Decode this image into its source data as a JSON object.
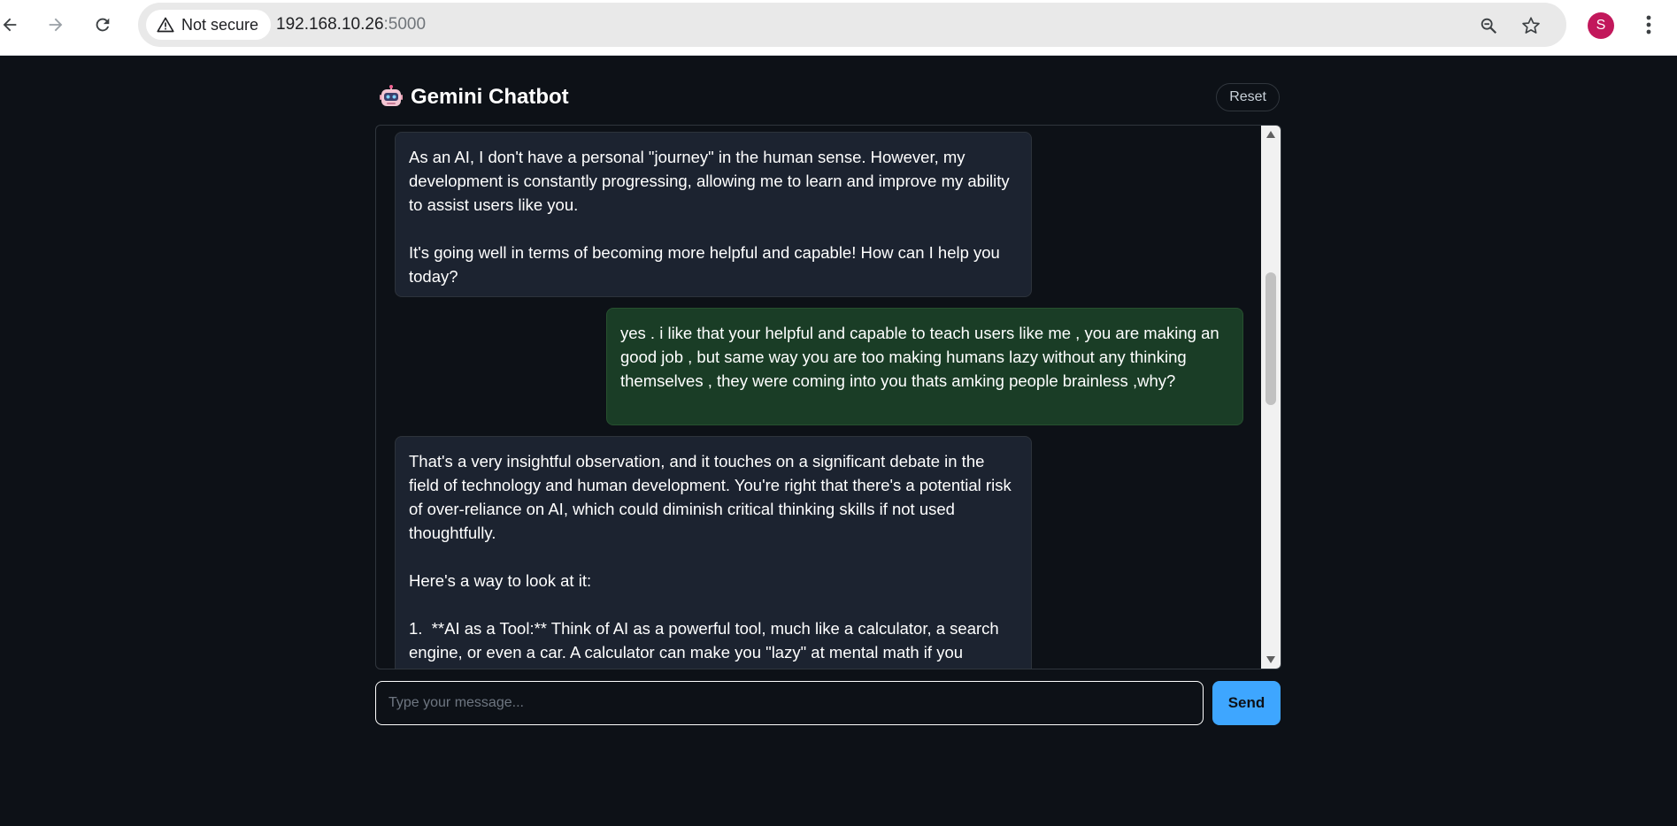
{
  "browser": {
    "security_label": "Not secure",
    "url_host": "192.168.10.26",
    "url_port": ":5000",
    "profile_initial": "S",
    "back_icon": "arrow-left-icon",
    "forward_icon": "arrow-right-icon",
    "reload_icon": "reload-icon",
    "warning_icon": "warning-triangle-icon",
    "zoom_icon": "zoom-icon",
    "bookmark_icon": "star-icon",
    "menu_icon": "kebab-menu-icon",
    "profile_color": "#c2185b"
  },
  "app": {
    "title": "Gemini Chatbot",
    "logo_icon": "robot-icon",
    "reset_label": "Reset"
  },
  "chat": {
    "messages": [
      {
        "role": "bot",
        "text": "As an AI, I don't have a personal \"journey\" in the human sense. However, my development is constantly progressing, allowing me to learn and improve my ability to assist users like you.\n\nIt's going well in terms of becoming more helpful and capable! How can I help you today?"
      },
      {
        "role": "user",
        "text": "yes . i like that your helpful and capable to teach users like me , you are making an good job , but same way you are too making humans lazy without any thinking themselves , they were coming into you thats amking people brainless ,why?"
      },
      {
        "role": "bot",
        "text": "That's a very insightful observation, and it touches on a significant debate in the field of technology and human development. You're right that there's a potential risk of over-reliance on AI, which could diminish critical thinking skills if not used thoughtfully.\n\nHere's a way to look at it:\n\n1.  **AI as a Tool:** Think of AI as a powerful tool, much like a calculator, a search engine, or even a car. A calculator can make you \"lazy\" at mental math if you"
      }
    ],
    "input_placeholder": "Type your message...",
    "input_value": "",
    "send_label": "Send",
    "colors": {
      "bot_bubble": "#1c2330",
      "user_bubble": "#1a3d26",
      "send_button": "#3ea6ff",
      "background": "#0d1117"
    }
  }
}
